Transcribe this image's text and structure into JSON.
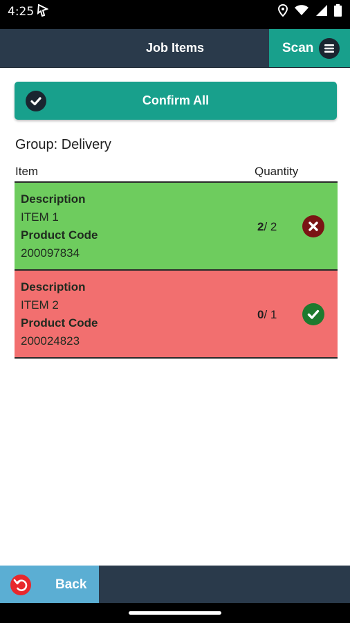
{
  "status_bar": {
    "time": "4:25",
    "icons": [
      "navigation-arrow-icon",
      "location-icon",
      "wifi-icon",
      "cellular-signal-icon",
      "battery-icon"
    ]
  },
  "header": {
    "title": "Job Items",
    "scan_label": "Scan",
    "menu_icon": "menu-icon"
  },
  "confirm_all": {
    "label": "Confirm All",
    "icon": "check-circle-icon"
  },
  "group": {
    "label": "Group: Delivery"
  },
  "table": {
    "columns": [
      "Item",
      "Quantity"
    ],
    "rows": [
      {
        "description_label": "Description",
        "description": "ITEM 1",
        "product_code_label": "Product Code",
        "product_code": "200097834",
        "qty_done": "2",
        "qty_total": "/ 2",
        "action_icon": "remove-icon",
        "status_color": "#6ecc5e"
      },
      {
        "description_label": "Description",
        "description": "ITEM 2",
        "product_code_label": "Product Code",
        "product_code": "200024823",
        "qty_done": "0",
        "qty_total": "/ 1",
        "action_icon": "check-icon",
        "status_color": "#f26f6f"
      }
    ]
  },
  "footer": {
    "back_label": "Back",
    "back_icon": "undo-icon"
  },
  "colors": {
    "header_bg": "#2a3a4b",
    "accent": "#18a08c",
    "back_button": "#5baed3",
    "complete_row": "#6ecc5e",
    "pending_row": "#f26f6f"
  }
}
